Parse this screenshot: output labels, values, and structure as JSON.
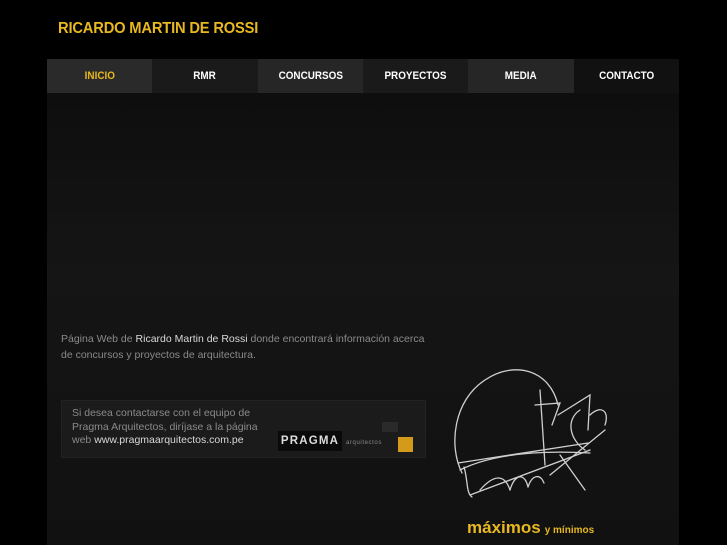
{
  "site": {
    "title": "RICARDO MARTIN DE ROSSI"
  },
  "nav": {
    "items": [
      {
        "label": "INICIO"
      },
      {
        "label": "RMR"
      },
      {
        "label": "CONCURSOS"
      },
      {
        "label": "PROYECTOS"
      },
      {
        "label": "MEDIA"
      },
      {
        "label": "CONTACTO"
      }
    ]
  },
  "intro": {
    "prefix": "Página Web de ",
    "name": "Ricardo Martin de Rossi",
    "suffix": " donde  encontrará información acerca de concursos y proyectos de arquitectura."
  },
  "pragma": {
    "text": "Si desea contactarse con el equipo de Pragma Arquitectos, diríjase a la página web ",
    "link": "www.pragmaarquitectos.com.pe",
    "logo_word": "PRAGMA",
    "logo_sub": "arquitectos"
  },
  "tagline": {
    "big": "máximos",
    "small": "y mínimos"
  },
  "colors": {
    "accent": "#e8b820",
    "logo_square": "#d49a1a",
    "background": "#000000"
  }
}
